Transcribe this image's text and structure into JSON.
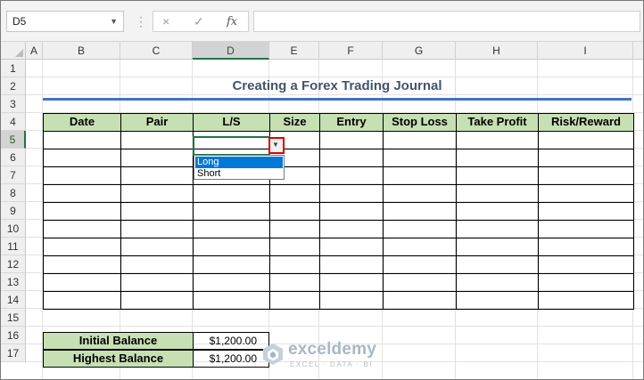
{
  "formula_bar": {
    "name_box": "D5",
    "formula": "",
    "cancel_icon": "×",
    "enter_icon": "✓",
    "fx_icon": "fx",
    "separator": "⋮",
    "name_box_arrow": "▼"
  },
  "columns": [
    "A",
    "B",
    "C",
    "D",
    "E",
    "F",
    "G",
    "H",
    "I"
  ],
  "rows": [
    "1",
    "2",
    "3",
    "4",
    "5",
    "6",
    "7",
    "8",
    "9",
    "10",
    "11",
    "12",
    "13",
    "14",
    "15",
    "16",
    "17"
  ],
  "selected_cell": {
    "column": "D",
    "row": "5"
  },
  "sheet": {
    "title": "Creating a Forex Trading Journal",
    "title_color": "#44546A",
    "rule_color": "#4472C4",
    "header_fill": "#C6E0B4",
    "journal_headers": [
      "Date",
      "Pair",
      "L/S",
      "Size",
      "Entry",
      "Stop Loss",
      "Take Profit",
      "Risk/Reward"
    ],
    "journal_body_rows": 10,
    "balances": [
      {
        "label": "Initial Balance",
        "value": "$1,200.00"
      },
      {
        "label": "Highest Balance",
        "value": "$1,200.00"
      }
    ]
  },
  "validation_dropdown": {
    "arrow_icon": "▼",
    "options": [
      "Long",
      "Short"
    ],
    "highlighted": "Long",
    "highlight_color": "#0078D7",
    "button_outline_color": "#E00000"
  },
  "watermark": {
    "name": "exceldemy",
    "tagline": "EXCEL · DATA · BI"
  }
}
